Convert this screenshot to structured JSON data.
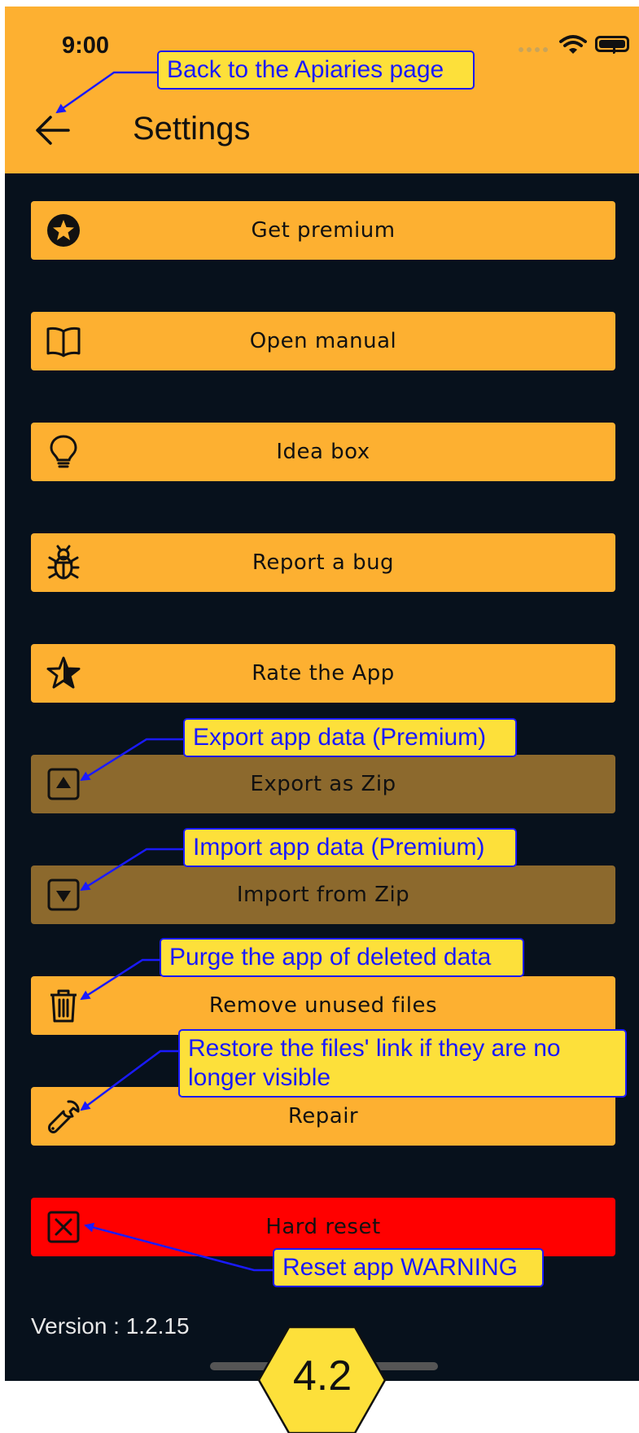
{
  "status_bar": {
    "time": "9:00"
  },
  "header": {
    "title": "Settings",
    "back_icon": "arrow-left-icon"
  },
  "buttons": [
    {
      "label": "Get premium",
      "icon": "star-circle-icon",
      "state": "enabled"
    },
    {
      "label": "Open manual",
      "icon": "book-icon",
      "state": "enabled"
    },
    {
      "label": "Idea box",
      "icon": "lightbulb-icon",
      "state": "enabled"
    },
    {
      "label": "Report a bug",
      "icon": "bug-icon",
      "state": "enabled"
    },
    {
      "label": "Rate the App",
      "icon": "star-outline-icon",
      "state": "enabled"
    },
    {
      "label": "Export as Zip",
      "icon": "export-icon",
      "state": "disabled"
    },
    {
      "label": "Import from Zip",
      "icon": "import-icon",
      "state": "disabled"
    },
    {
      "label": "Remove unused files",
      "icon": "trash-icon",
      "state": "enabled"
    },
    {
      "label": "Repair",
      "icon": "wrench-icon",
      "state": "enabled"
    },
    {
      "label": "Hard reset",
      "icon": "close-box-icon",
      "state": "danger"
    }
  ],
  "version": "Version : 1.2.15",
  "annotations": {
    "back": "Back to the Apiaries page",
    "export": "Export app data (Premium)",
    "import": "Import app data (Premium)",
    "purge": "Purge the app of deleted data",
    "repair": "Restore the files' link if they are no longer visible",
    "reset": "Reset app WARNING"
  },
  "badge": "4.2",
  "colors": {
    "accent": "#fdb031",
    "disabled": "#8c692d",
    "danger": "#ff0000",
    "background": "#07111c",
    "annotation_fill": "#fde03a",
    "annotation_stroke": "#1a1aff"
  }
}
